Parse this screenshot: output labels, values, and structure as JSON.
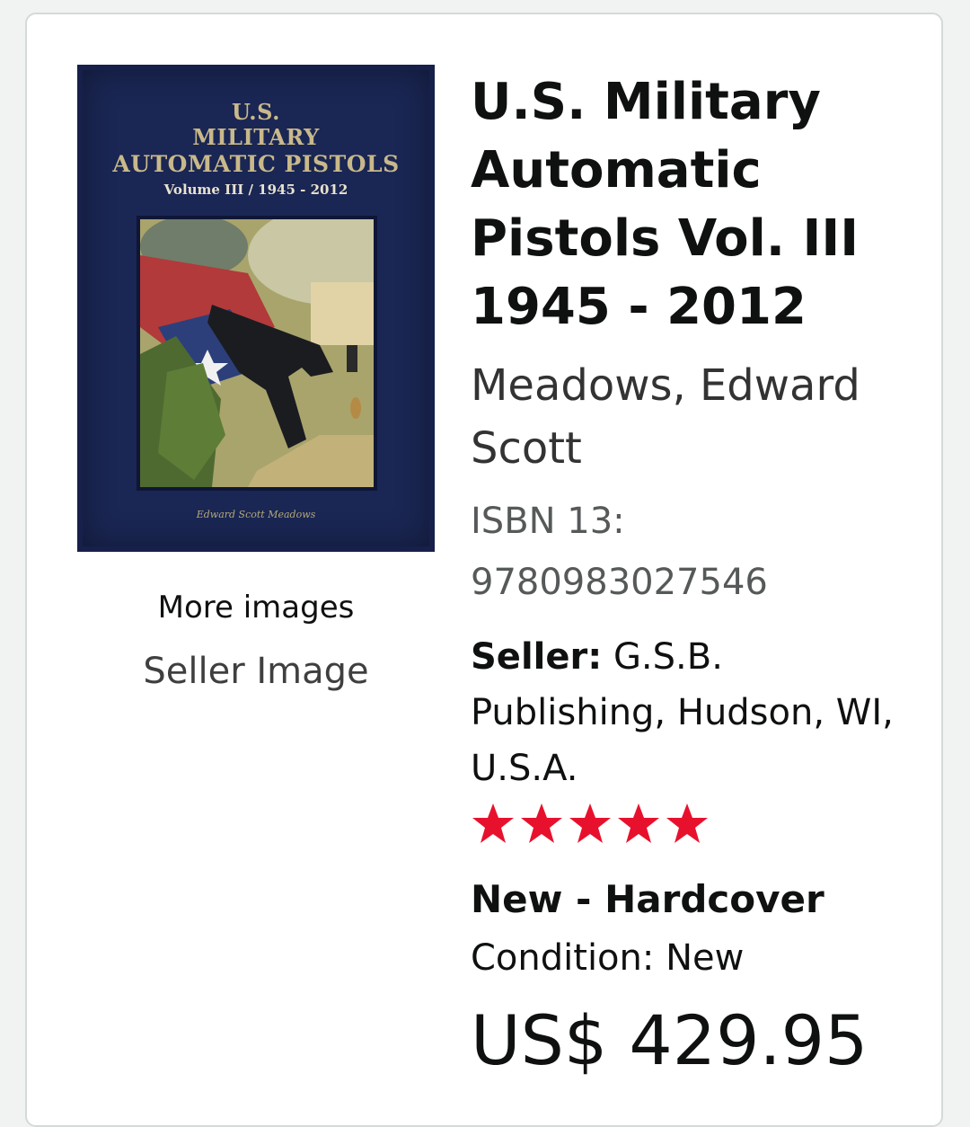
{
  "listing": {
    "cover": {
      "title_line1": "U.S.",
      "title_line2": "MILITARY",
      "title_line3": "AUTOMATIC PISTOLS",
      "subtitle": "Volume III / 1945 - 2012",
      "author": "Edward Scott Meadows"
    },
    "more_images_label": "More images",
    "seller_image_label": "Seller Image",
    "title": "U.S. Military Automatic Pistols Vol. III 1945 - 2012",
    "author": "Meadows, Edward Scott",
    "isbn_label": "ISBN 13:",
    "isbn_value": "9780983027546",
    "seller_label": "Seller:",
    "seller_value": "G.S.B. Publishing, Hudson, WI, U.S.A.",
    "seller_rating": 5,
    "star_color": "#e8112d",
    "binding": "New - Hardcover",
    "condition": "Condition: New",
    "price": "US$ 429.95"
  }
}
